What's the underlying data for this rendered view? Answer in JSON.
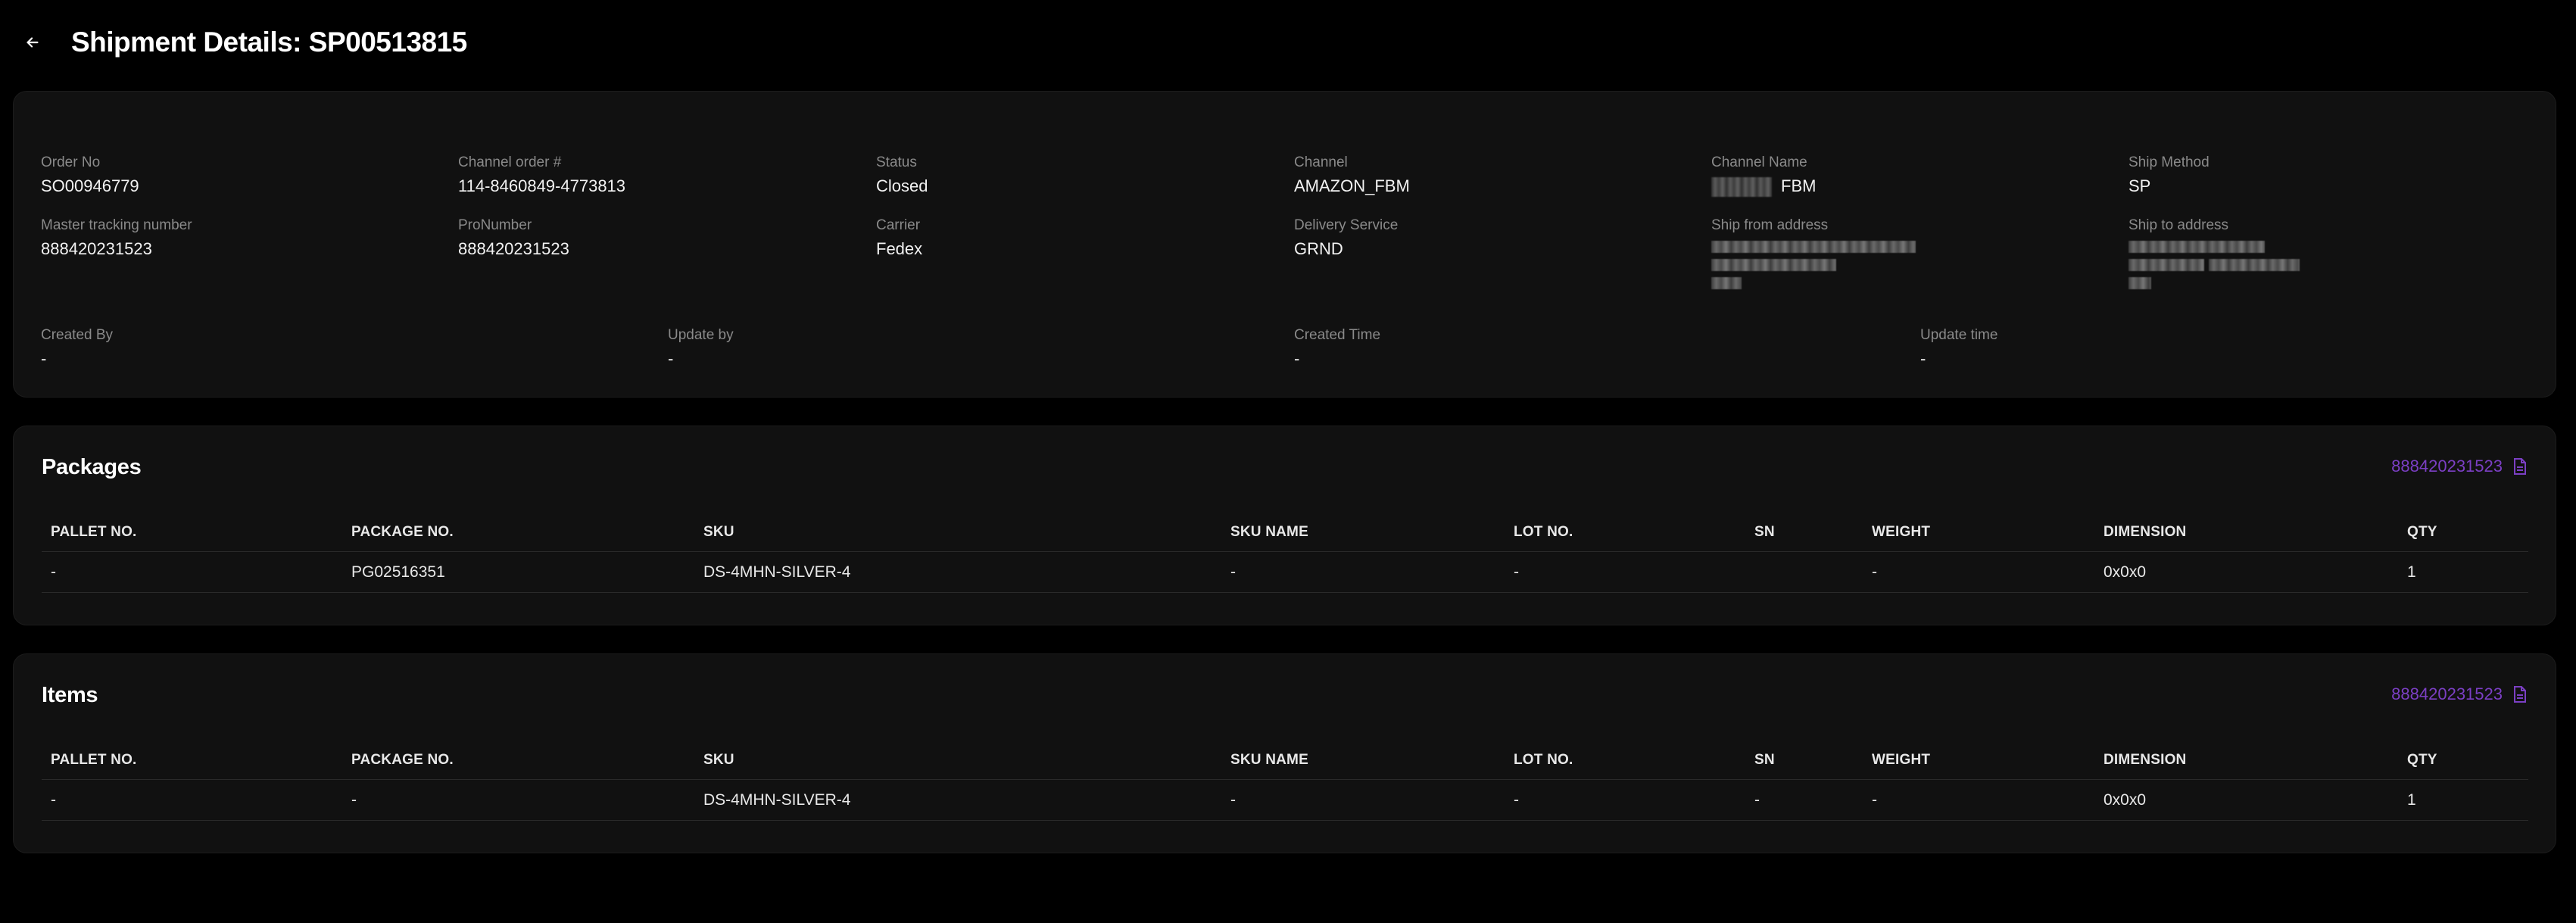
{
  "header": {
    "title": "Shipment Details: SP00513815"
  },
  "details": {
    "order_no": {
      "label": "Order No",
      "value": "SO00946779"
    },
    "channel_order": {
      "label": "Channel order #",
      "value": "114-8460849-4773813"
    },
    "status": {
      "label": "Status",
      "value": "Closed"
    },
    "channel": {
      "label": "Channel",
      "value": "AMAZON_FBM"
    },
    "channel_name": {
      "label": "Channel Name",
      "value": "FBM"
    },
    "ship_method": {
      "label": "Ship Method",
      "value": "SP"
    },
    "master_tracking": {
      "label": "Master tracking number",
      "value": "888420231523"
    },
    "pro_number": {
      "label": "ProNumber",
      "value": "888420231523"
    },
    "carrier": {
      "label": "Carrier",
      "value": "Fedex"
    },
    "delivery_service": {
      "label": "Delivery Service",
      "value": "GRND"
    },
    "ship_from": {
      "label": "Ship from address"
    },
    "ship_to": {
      "label": "Ship to address"
    },
    "created_by": {
      "label": "Created By",
      "value": "-"
    },
    "update_by": {
      "label": "Update by",
      "value": "-"
    },
    "created_time": {
      "label": "Created Time",
      "value": "-"
    },
    "update_time": {
      "label": "Update time",
      "value": "-"
    }
  },
  "columns": [
    "PALLET NO.",
    "PACKAGE NO.",
    "SKU",
    "SKU NAME",
    "LOT NO.",
    "SN",
    "WEIGHT",
    "DIMENSION",
    "QTY"
  ],
  "packages": {
    "title": "Packages",
    "tracking_link": "888420231523",
    "rows": [
      [
        "-",
        "PG02516351",
        "DS-4MHN-SILVER-4",
        "-",
        "-",
        "",
        "-",
        "0x0x0",
        "1"
      ]
    ]
  },
  "items": {
    "title": "Items",
    "tracking_link": "888420231523",
    "rows": [
      [
        "-",
        "-",
        "DS-4MHN-SILVER-4",
        "-",
        "-",
        "-",
        "-",
        "0x0x0",
        "1"
      ]
    ]
  },
  "colors": {
    "background": "#000000",
    "card": "#111111",
    "link": "#7b3fc4",
    "label": "#8a8a8a"
  },
  "icons": {
    "back": "arrow-left-icon",
    "document": "document-icon"
  }
}
